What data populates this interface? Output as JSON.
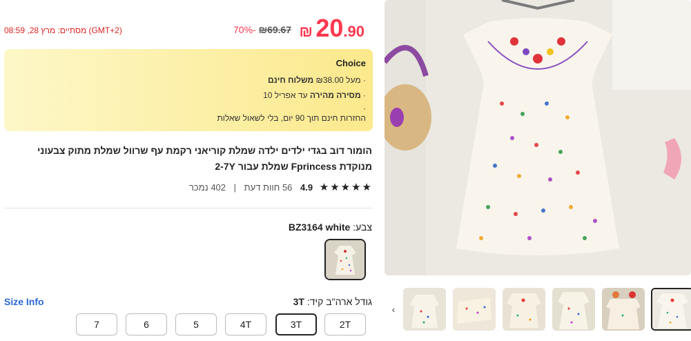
{
  "price": {
    "main": "20",
    "decimals": ".90",
    "currency": "₪",
    "original": "69.67",
    "original_currency": "₪",
    "discount": "70%-",
    "ends_text": "מסתיים: מרץ 28, 08:59 (GMT+2)"
  },
  "choice": {
    "title": "Choice",
    "line1_bold": "משלוח חינם",
    "line1_rest": "מעל ₪38.00",
    "line2_bold": "מסירה מהירה",
    "line2_rest": "עד אפריל 10",
    "line3": "·",
    "line4": "החזרות חינם תוך 90 יום, בלי לשאול שאלות",
    "bullet": "·"
  },
  "product": {
    "title": "הומור דוב בגדי ילדים ילדה שמלת קוריאני רקמת עף שרוול שמלת מתוק צבעוני מנוקדת Fprincess שמלת עבור 2-7Y"
  },
  "rating": {
    "stars": "★★★★★",
    "score": "4.9",
    "reviews": "56 חוות דעת",
    "separator": "|",
    "sold": "402 נמכר"
  },
  "color": {
    "label": "צבע:",
    "value": "BZ3164 white"
  },
  "size": {
    "label": "גודל ארה\"ב קיד:",
    "value": "3T",
    "info": "Size Info",
    "options": [
      "2T",
      "3T",
      "4T",
      "5",
      "6",
      "7"
    ],
    "selected": "3T"
  },
  "gallery": {
    "prev_icon": "chevron-left-icon",
    "prev_glyph": "‹",
    "thumb_count": 6,
    "selected_thumb": 6
  },
  "colors": {
    "accent": "#fd384f",
    "link": "#2a67d8",
    "choice_bg_start": "#fdf7c8",
    "choice_bg_end": "#fce98c"
  }
}
